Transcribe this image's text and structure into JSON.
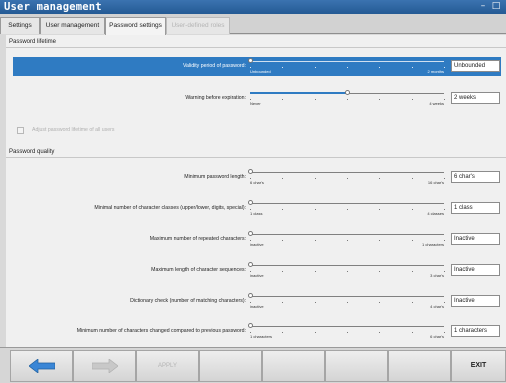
{
  "window": {
    "title": "User management",
    "minimize": "–",
    "maximize": "□"
  },
  "tabs": [
    {
      "label": "Settings"
    },
    {
      "label": "User management"
    },
    {
      "label": "Password settings"
    },
    {
      "label": "User-defined roles"
    }
  ],
  "lifetime": {
    "heading": "Password lifetime",
    "validity": {
      "label": "Validity period of password:",
      "min": "Unbounded",
      "max": "2 months",
      "value": "Unbounded",
      "position": 0.0
    },
    "warning": {
      "label": "Warning before expiration:",
      "min": "Never",
      "max": "4 weeks",
      "value": "2 weeks",
      "position": 0.5
    },
    "adjust_label": "Adjust password lifetime of all users"
  },
  "quality": {
    "heading": "Password quality",
    "rows": [
      {
        "label": "Minimum password length:",
        "min": "6 char's",
        "max": "16 char's",
        "value": "6 char's"
      },
      {
        "label": "Minimal number of character classes (upper/lower, digits, special):",
        "min": "1 class",
        "max": "4 classes",
        "value": "1 class"
      },
      {
        "label": "Maximum number of repeated characters:",
        "min": "inactive",
        "max": "1 characters",
        "value": "Inactive"
      },
      {
        "label": "Maximum length of character sequences:",
        "min": "inactive",
        "max": "3 char's",
        "value": "Inactive"
      },
      {
        "label": "Dictionary check (number of matching characters):",
        "min": "inactive",
        "max": "4 char's",
        "value": "Inactive"
      },
      {
        "label": "Minimum number of characters changed compared to previous password:",
        "min": "1 characters",
        "max": "6 char's",
        "value": "1 characters"
      }
    ]
  },
  "softkeys": {
    "apply": "APPLY",
    "exit": "EXIT",
    "back_icon": "arrow-left-icon",
    "forward_icon": "arrow-right-icon"
  },
  "colors": {
    "title_bar": "#245a94",
    "selection": "#2f7bc2",
    "accent_arrow": "#3a86d6"
  }
}
